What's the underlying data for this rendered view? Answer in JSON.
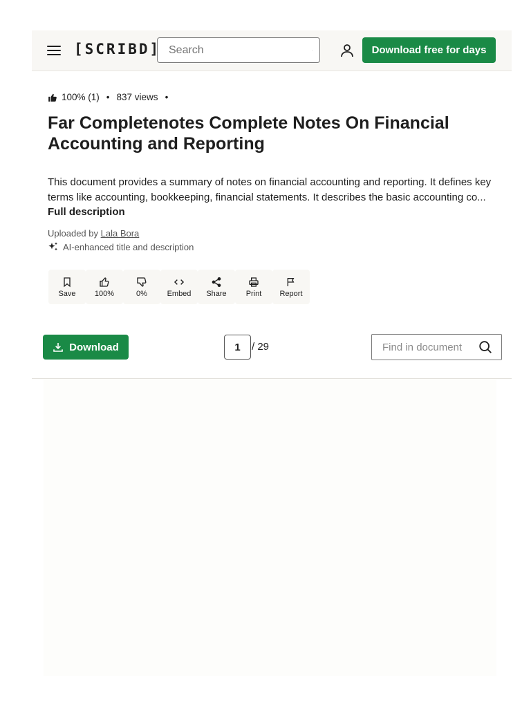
{
  "header": {
    "logo": "[SCRIBD]",
    "search_placeholder": "Search",
    "download_free_label": "Download free for days"
  },
  "meta": {
    "rating": "100% (1)",
    "views": "837 views",
    "separator": "•"
  },
  "document": {
    "title": "Far Completenotes Complete Notes On Financial Accounting and Reporting",
    "description": "This document provides a summary of notes on financial accounting and reporting. It defines key terms like accounting, bookkeeping, financial statements. It describes the basic accounting co...",
    "full_description_label": "Full description",
    "uploaded_by_prefix": "Uploaded by",
    "uploader": "Lala Bora",
    "ai_note": "AI-enhanced title and description"
  },
  "actions": [
    {
      "label": "Save",
      "icon": "bookmark-icon"
    },
    {
      "label": "100%",
      "icon": "thumbs-up-icon"
    },
    {
      "label": "0%",
      "icon": "thumbs-down-icon"
    },
    {
      "label": "Embed",
      "icon": "code-icon"
    },
    {
      "label": "Share",
      "icon": "share-icon"
    },
    {
      "label": "Print",
      "icon": "printer-icon"
    },
    {
      "label": "Report",
      "icon": "flag-icon"
    }
  ],
  "toolbar": {
    "download_label": "Download",
    "current_page": "1",
    "total_pages": "/ 29",
    "find_placeholder": "Find in document"
  },
  "colors": {
    "accent": "#1a8a46",
    "header_bg": "#f8f7f4"
  }
}
